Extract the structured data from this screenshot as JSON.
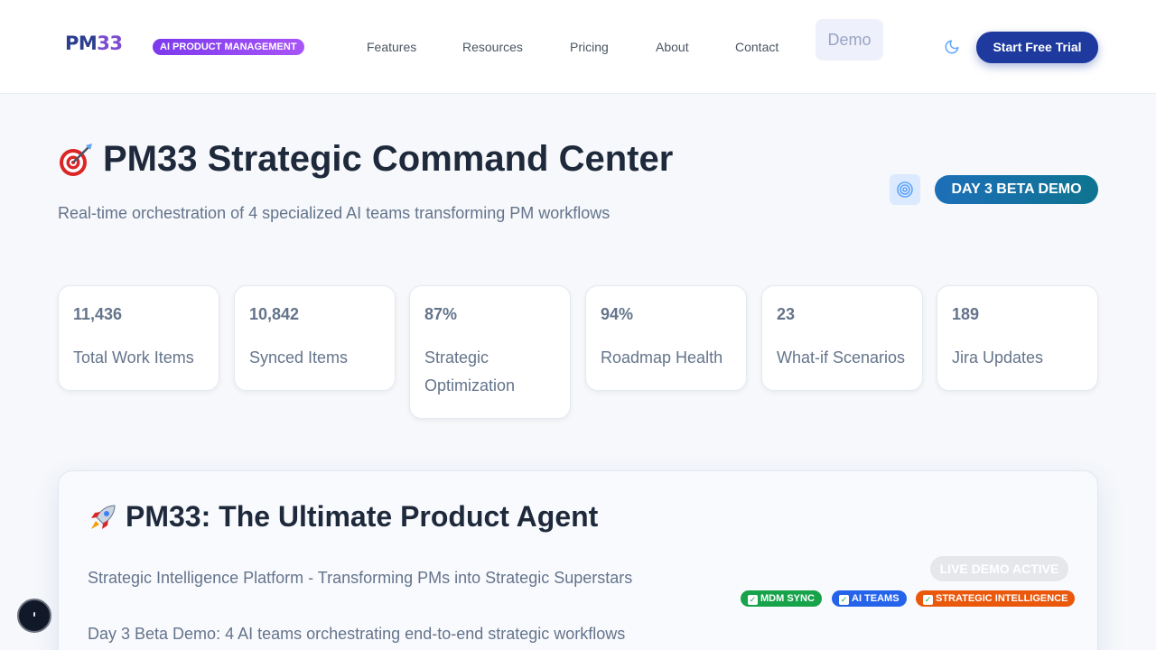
{
  "header": {
    "logo_main": "PM",
    "logo_num": "33",
    "logo_badge": "AI PRODUCT MANAGEMENT",
    "nav": [
      "Features",
      "Resources",
      "Pricing",
      "About",
      "Contact"
    ],
    "demo_label": "Demo",
    "theme_icon": "moon-icon",
    "cta_label": "Start Free Trial"
  },
  "hero": {
    "title": "PM33 Strategic Command Center",
    "title_icon": "target-dart-icon",
    "subtitle": "Real-time orchestration of 4 specialized AI teams transforming PM workflows",
    "target_icon": "target-icon",
    "beta_badge": "DAY 3 BETA DEMO"
  },
  "stats": [
    {
      "value": "11,436",
      "label": "Total Work Items"
    },
    {
      "value": "10,842",
      "label": "Synced Items"
    },
    {
      "value": "87%",
      "label": "Strategic Optimization"
    },
    {
      "value": "94%",
      "label": "Roadmap Health"
    },
    {
      "value": "23",
      "label": "What-if Scenarios"
    },
    {
      "value": "189",
      "label": "Jira Updates"
    }
  ],
  "agent": {
    "title_icon": "rocket-icon",
    "title": "PM33: The Ultimate Product Agent",
    "subtitle1": "Strategic Intelligence Platform - Transforming PMs into Strategic Superstars",
    "subtitle2": "Day 3 Beta Demo: 4 AI teams orchestrating end-to-end strategic workflows",
    "live_badge": "LIVE DEMO ACTIVE",
    "chips": [
      {
        "label": "MDM SYNC",
        "color": "#16a34a"
      },
      {
        "label": "AI TEAMS",
        "color": "#2563eb"
      },
      {
        "label": "STRATEGIC INTELLIGENCE",
        "color": "#ea580c"
      }
    ]
  },
  "colors": {
    "brand": "#1e3a9f",
    "accent": "#7c3aed",
    "background": "#f6f8fb"
  }
}
